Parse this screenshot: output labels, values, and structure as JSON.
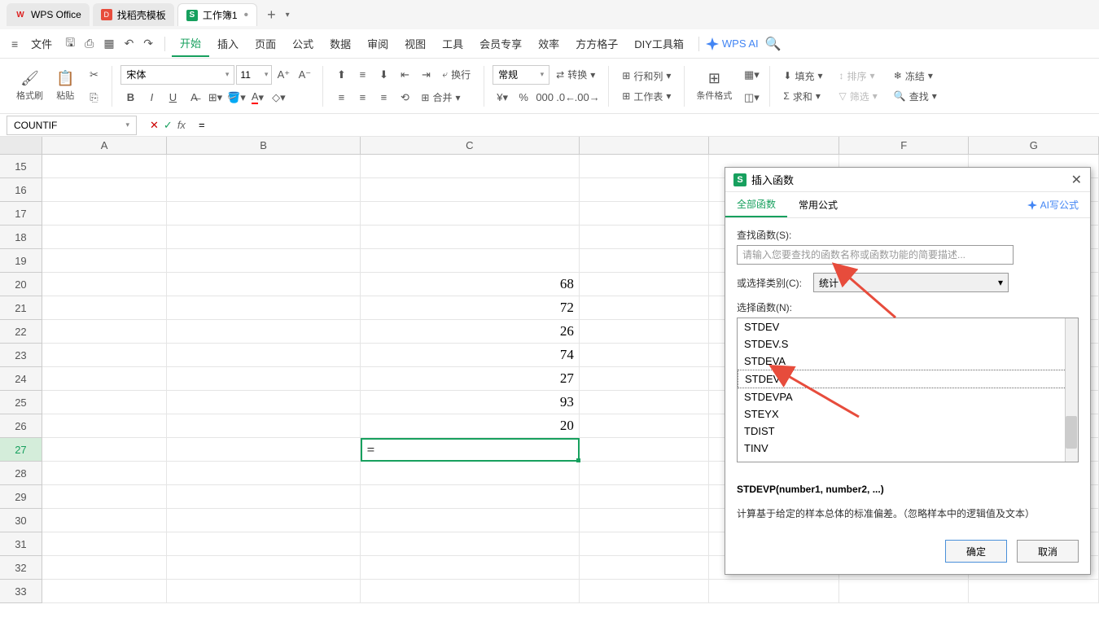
{
  "titlebar": {
    "tab1": "WPS Office",
    "tab2": "找稻壳模板",
    "tab3": "工作簿1"
  },
  "menubar": {
    "file": "文件",
    "items": [
      "开始",
      "插入",
      "页面",
      "公式",
      "数据",
      "审阅",
      "视图",
      "工具",
      "会员专享",
      "效率",
      "方方格子",
      "DIY工具箱"
    ],
    "ai": "WPS AI"
  },
  "ribbon": {
    "format_painter": "格式刷",
    "paste": "粘贴",
    "font": "宋体",
    "font_size": "11",
    "wrap": "换行",
    "merge": "合并",
    "number_format": "常规",
    "convert": "转换",
    "rows_cols": "行和列",
    "worksheet": "工作表",
    "cond_format": "条件格式",
    "fill": "填充",
    "sum": "求和",
    "sort": "排序",
    "filter": "筛选",
    "freeze": "冻结",
    "find": "查找"
  },
  "formulabar": {
    "namebox": "COUNTIF",
    "formula": "="
  },
  "sheet": {
    "cols": [
      "A",
      "B",
      "C"
    ],
    "rows": [
      "15",
      "16",
      "17",
      "18",
      "19",
      "20",
      "21",
      "22",
      "23",
      "24",
      "25",
      "26",
      "27",
      "28",
      "29",
      "30",
      "31",
      "32",
      "33"
    ],
    "data_c": {
      "20": "68",
      "21": "72",
      "22": "26",
      "23": "74",
      "24": "27",
      "25": "93",
      "26": "20",
      "27": "="
    }
  },
  "dialog": {
    "title": "插入函数",
    "tab_all": "全部函数",
    "tab_common": "常用公式",
    "ai_write": "AI写公式",
    "search_label": "查找函数(S):",
    "search_placeholder": "请输入您要查找的函数名称或函数功能的简要描述...",
    "category_label": "或选择类别(C):",
    "category_value": "统计",
    "select_label": "选择函数(N):",
    "functions": [
      "STDEV",
      "STDEV.S",
      "STDEVA",
      "STDEVP",
      "STDEVPA",
      "STEYX",
      "TDIST",
      "TINV"
    ],
    "func_sig": "STDEVP(number1, number2, ...)",
    "func_desc": "计算基于给定的样本总体的标准偏差。（忽略样本中的逻辑值及文本）",
    "ok": "确定",
    "cancel": "取消"
  }
}
